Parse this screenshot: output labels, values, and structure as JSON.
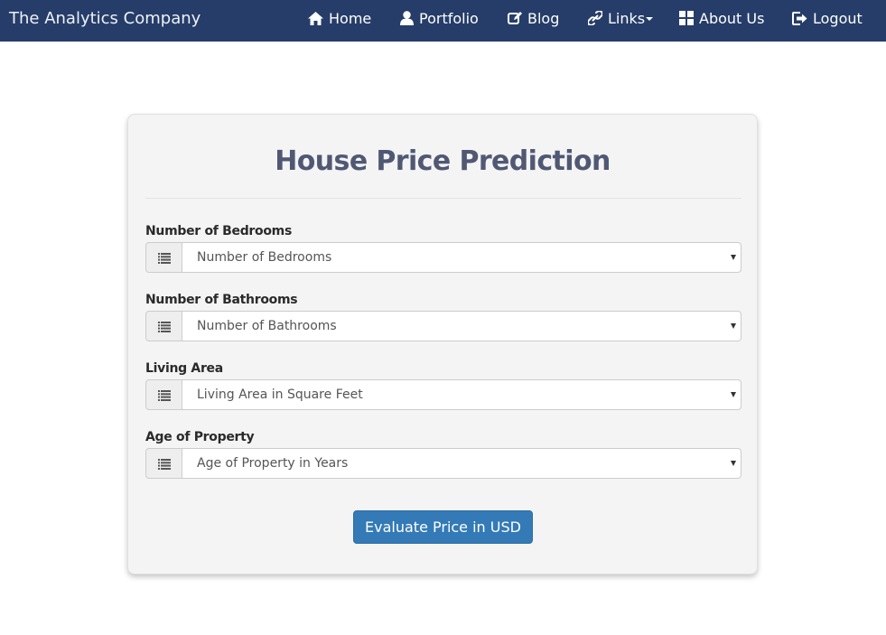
{
  "navbar": {
    "brand": "The Analytics Company",
    "items": [
      {
        "label": "Home",
        "icon": "home-icon"
      },
      {
        "label": "Portfolio",
        "icon": "user-icon"
      },
      {
        "label": "Blog",
        "icon": "edit-icon"
      },
      {
        "label": "Links",
        "icon": "link-icon",
        "has_caret": true
      },
      {
        "label": "About Us",
        "icon": "grid-icon"
      },
      {
        "label": "Logout",
        "icon": "logout-icon"
      }
    ],
    "background": "#263d69"
  },
  "form": {
    "title": "House Price Prediction",
    "fields": [
      {
        "label": "Number of Bedrooms",
        "selected": "Number of Bedrooms",
        "icon": "list-icon"
      },
      {
        "label": "Number of Bathrooms",
        "selected": "Number of Bathrooms",
        "icon": "list-icon"
      },
      {
        "label": "Living Area",
        "selected": "Living Area in Square Feet",
        "icon": "list-icon"
      },
      {
        "label": "Age of Property",
        "selected": "Age of Property in Years",
        "icon": "list-icon"
      }
    ],
    "submit_label": "Evaluate Price in USD",
    "accent": "#337ab7"
  }
}
